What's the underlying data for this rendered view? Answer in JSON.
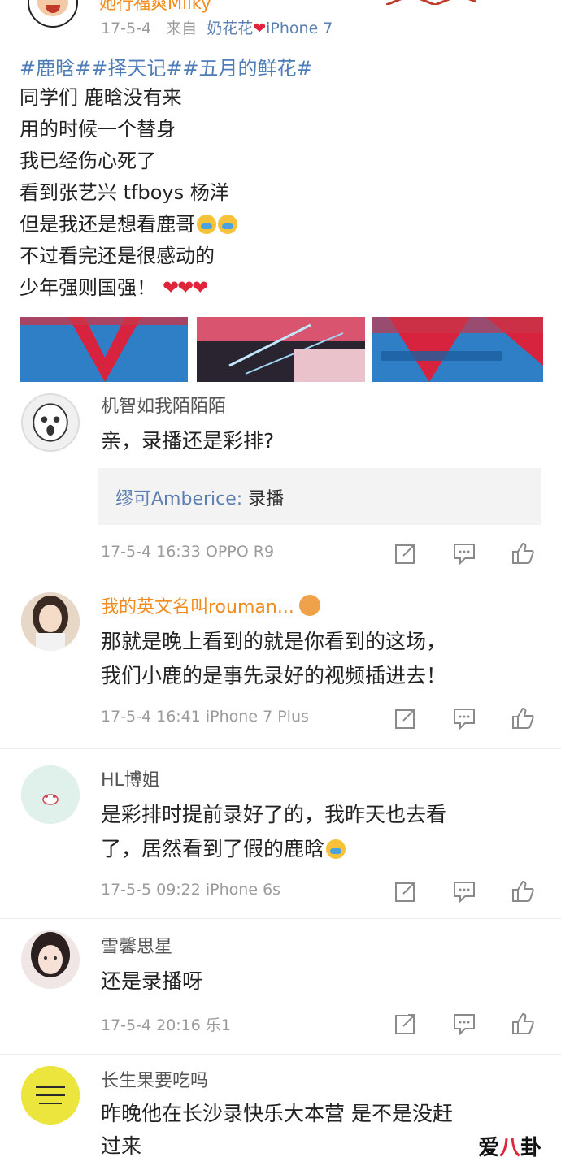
{
  "post": {
    "username": "她行福爽Milky",
    "date": "17-5-4",
    "from_label": "来自",
    "source": "奶花花",
    "device": "iPhone 7",
    "hashtags": "#鹿晗##择天记##五月的鲜花#",
    "lines": [
      "同学们 鹿晗没有来",
      "用的时候一个替身",
      "我已经伤心死了",
      "看到张艺兴 tfboys 杨洋",
      "但是我还是想看鹿哥",
      "不过看完还是很感动的",
      "少年强则国强！"
    ],
    "hearts": "❤❤❤"
  },
  "comments": [
    {
      "user": "机智如我陌陌陌",
      "text": [
        "亲，录播还是彩排?"
      ],
      "reply": {
        "user": "缪可Amberice:",
        "text": " 录播"
      },
      "meta": "17-5-4 16:33 OPPO R9"
    },
    {
      "user": "我的英文名叫rouman...",
      "text": [
        "那就是晚上看到的就是你看到的这场，",
        "我们小鹿的是事先录好的视频插进去！"
      ],
      "meta": "17-5-4 16:41 iPhone 7 Plus"
    },
    {
      "user": "HL博姐",
      "text": [
        "是彩排时提前录好了的，我昨天也去看",
        "了，居然看到了假的鹿晗"
      ],
      "meta": "17-5-5 09:22 iPhone 6s"
    },
    {
      "user": "雪馨思星",
      "text": [
        "还是录播呀"
      ],
      "meta": "17-5-4 20:16 乐1"
    },
    {
      "user": "长生果要吃吗",
      "text": [
        "昨晚他在长沙录快乐大本营 是不是没赶",
        "过来"
      ],
      "meta": ""
    }
  ],
  "watermark": {
    "left": "爱",
    "mid": "八",
    "right": "卦"
  },
  "colors": {
    "accent_blue": "#5b7fb0",
    "orange": "#f28c1f",
    "meta_gray": "#9b9b9b"
  }
}
